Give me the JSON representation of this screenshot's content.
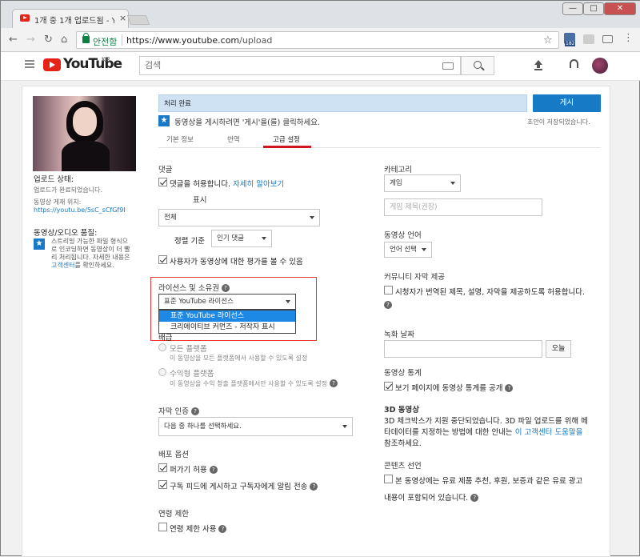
{
  "browser": {
    "tab_title": "1개 중 1개 업로드됨 - YouTube",
    "tab_close": "×",
    "window_controls": [
      "—",
      "□",
      "✕"
    ],
    "secure_label": "안전함",
    "url_host": "https://www.youtube.com",
    "url_path": "/upload",
    "ext_badge": "182"
  },
  "yt": {
    "logo_text": "YouTube",
    "logo_region": "KR",
    "search_placeholder": "검색"
  },
  "status": {
    "processing": "처리 완료",
    "publish_button": "게시",
    "hint": "동영상을 게시하려면 '게시'을(를) 클릭하세요.",
    "draft_saved": "초안이 저장되었습니다."
  },
  "tabs": [
    {
      "label": "기본 정보",
      "active": false
    },
    {
      "label": "번역",
      "active": false
    },
    {
      "label": "고급 설정",
      "active": true
    }
  ],
  "left": {
    "upload_status_title": "업로드 상태:",
    "upload_status_text": "업로드가 완료되었습니다.",
    "video_url_label": "동영상 게재 위치:",
    "video_url": "https://youtu.be/5sC_sCfGf9I",
    "quality_title": "동영상/오디오 품질:",
    "quality_text": [
      "스트리밍 가능한 파일 형식으",
      "로 인코딩하면 동영상이 더 빨",
      "리 처리됩니다. 자세한 내용은",
      "고객센터를 확인하세요."
    ],
    "quality_link": "고객센터"
  },
  "comments": {
    "title": "댓글",
    "allow_label": "댓글을 허용합니다.",
    "learn_more": "자세히 알아보기",
    "display_label": "표시",
    "display_value": "전체",
    "sort_label": "정렬 기준",
    "sort_value": "인기 댓글",
    "ratings_label": "사용자가 동영상에 대한 평가를 볼 수 있음"
  },
  "license": {
    "title": "라이선스 및 소유권",
    "selected": "표준 YouTube 라이선스",
    "options": [
      "표준 YouTube 라이선스",
      "크리에이티브 커먼즈 - 저작자 표시"
    ]
  },
  "syndication": {
    "title_partial": "배급",
    "all_platforms": "모든 플랫폼",
    "all_platforms_desc": "이 동영상을 모든 플랫폼에서 사용할 수 있도록 설정",
    "monetized": "수익형 플랫폼",
    "monetized_desc": "이 동영상을 수익 창출 플랫폼에서만 사용할 수 있도록 설정"
  },
  "caption_cert": {
    "title": "자막 인증",
    "value": "다음 중 하나를 선택하세요."
  },
  "distribution": {
    "title": "배포 옵션",
    "embed": "퍼가기 허용",
    "notify": "구독 피드에 게시하고 구독자에게 알림 전송"
  },
  "age": {
    "title": "연령 제한",
    "label": "연령 제한 사용"
  },
  "right": {
    "category_title": "카테고리",
    "category_value": "게임",
    "game_title_placeholder": "게임 제목(권장)",
    "lang_title": "동영상 언어",
    "lang_value": "언어 선택",
    "community_title": "커뮤니티 자막 제공",
    "community_label": "시청자가 번역된 제목, 설명, 자막을 제공하도록 허용합니다.",
    "rec_date_title": "녹화 날짜",
    "today_button": "오늘",
    "stats_title": "동영상 통계",
    "stats_label": "보기 페이지에 동영상 통계를 공개",
    "three_d_title": "3D 동영상",
    "three_d_lines": [
      "3D 체크박스가 지원 중단되었습니다. 3D 파일 업로드를 위해 메",
      "타데이터를 지정하는 방법에 대한 안내는",
      "참조하세요."
    ],
    "three_d_link": "이 고객센터 도움말을",
    "content_title": "콘텐츠 선언",
    "content_line1": "본 동영상에는 유료 제품 추천, 후원, 보증과 같은 유료 광고",
    "content_line2": "내용이 포함되어 있습니다."
  },
  "colors": {
    "accent": "#167ac6",
    "yt_red": "#e62117",
    "progress": "#cfe2f3"
  }
}
